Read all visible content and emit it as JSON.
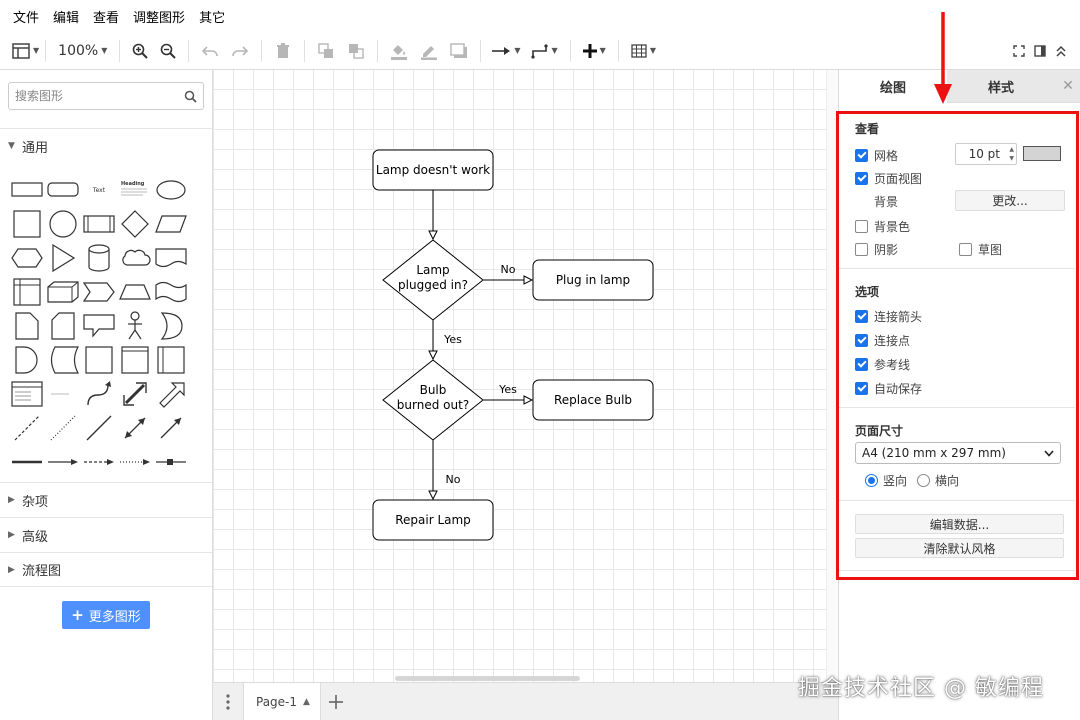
{
  "menu": [
    "文件",
    "编辑",
    "查看",
    "调整图形",
    "其它"
  ],
  "toolbar": {
    "zoom": "100%"
  },
  "left": {
    "search_placeholder": "搜索图形",
    "sections": {
      "general": "通用",
      "misc": "杂项",
      "advanced": "高级",
      "flowchart": "流程图"
    },
    "more_shapes": "更多图形",
    "shape_text_label": "Text",
    "shape_heading_label": "Heading"
  },
  "diagram": {
    "nodes": {
      "start": "Lamp doesn't work",
      "decision1_line1": "Lamp",
      "decision1_line2": "plugged in?",
      "plug": "Plug in lamp",
      "decision2_line1": "Bulb",
      "decision2_line2": "burned out?",
      "replace": "Replace Bulb",
      "repair": "Repair Lamp"
    },
    "edges": {
      "no1": "No",
      "yes1": "Yes",
      "yes2": "Yes",
      "no2": "No"
    }
  },
  "bottom": {
    "page_tab": "Page-1"
  },
  "right": {
    "tab_diagram": "绘图",
    "tab_style": "样式",
    "view_title": "查看",
    "grid": "网格",
    "grid_size": "10 pt",
    "page_view": "页面视图",
    "background": "背景",
    "change_button": "更改...",
    "background_color": "背景色",
    "shadow": "阴影",
    "sketch": "草图",
    "options_title": "选项",
    "connection_arrows": "连接箭头",
    "connection_points": "连接点",
    "guides": "参考线",
    "autosave": "自动保存",
    "page_size_title": "页面尺寸",
    "page_size_value": "A4 (210 mm x 297 mm)",
    "portrait": "竖向",
    "landscape": "横向",
    "edit_data": "编辑数据...",
    "clear_style": "清除默认风格",
    "checks": {
      "grid": true,
      "page_view": true,
      "background_color": false,
      "shadow": false,
      "sketch": false,
      "connection_arrows": true,
      "connection_points": true,
      "guides": true,
      "autosave": true
    },
    "orientation": "portrait"
  },
  "colors": {
    "highlight": "#ee1111",
    "accent": "#1a73e8",
    "button": "#4d90fe"
  },
  "watermark": "掘金技术社区 @ 敏编程"
}
